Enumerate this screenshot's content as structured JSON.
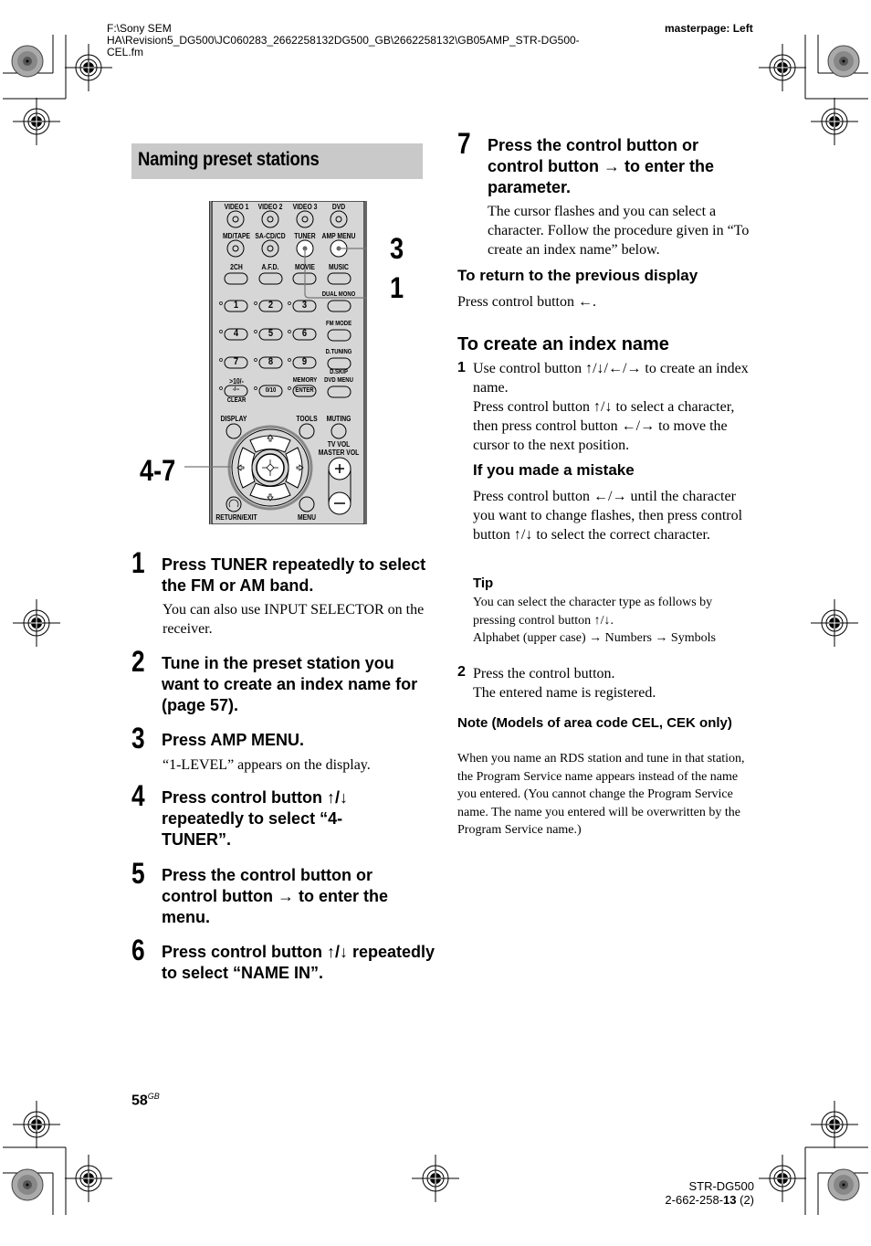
{
  "header": {
    "file_path_lines": [
      "F:\\Sony SEM",
      "HA\\Revision5_DG500\\JC060283_2662258132DG500_GB\\2662258132\\GB05AMP_STR-DG500-",
      "CEL.fm"
    ],
    "masterpage": "masterpage: Left"
  },
  "section": {
    "title": "Naming preset stations"
  },
  "figure": {
    "callouts": {
      "c3": "3",
      "c1": "1",
      "c47": "4-7"
    },
    "remote_buttons": {
      "row1": [
        "VIDEO 1",
        "VIDEO 2",
        "VIDEO 3",
        "DVD"
      ],
      "row2": [
        "MD/TAPE",
        "SA-CD/CD",
        "TUNER",
        "AMP MENU"
      ],
      "row3": [
        "2CH",
        "A.F.D.",
        "MOVIE",
        "MUSIC"
      ],
      "num_row1": [
        "1",
        "2",
        "3"
      ],
      "num_row1_side": "DUAL MONO",
      "num_row2": [
        "4",
        "5",
        "6"
      ],
      "num_row2_side": "FM MODE",
      "num_row3": [
        "7",
        "8",
        "9"
      ],
      "num_row3_side": "D.TUNING",
      "ten_label": ">10/-",
      "ten_key": "-/--",
      "clear": "CLEAR",
      "zero_key": "0/10",
      "memory": "MEMORY",
      "enter": "ENTER",
      "dskip": "D.SKIP",
      "dvd_menu": "DVD MENU",
      "display": "DISPLAY",
      "tools": "TOOLS",
      "muting": "MUTING",
      "tv_vol": "TV VOL",
      "master_vol": "MASTER VOL",
      "return_exit": "RETURN/EXIT",
      "menu": "MENU"
    }
  },
  "steps_left": [
    {
      "num": "1",
      "title": "Press TUNER repeatedly to select the FM or AM band.",
      "body": "You can also use INPUT SELECTOR on the receiver."
    },
    {
      "num": "2",
      "title": "Tune in the preset station you want to create an index name for (page 57).",
      "body": ""
    },
    {
      "num": "3",
      "title": "Press AMP MENU.",
      "body": "“1-LEVEL” appears on the display."
    },
    {
      "num": "4",
      "title": "Press control button ↑/↓ repeatedly to select “4-TUNER”.",
      "body": ""
    },
    {
      "num": "5",
      "title": "Press the control button or control button → to enter the menu.",
      "body": ""
    },
    {
      "num": "6",
      "title": "Press control button ↑/↓ repeatedly to select “NAME IN”.",
      "body": ""
    }
  ],
  "step7": {
    "num": "7",
    "title": "Press the control button or control button → to enter the parameter.",
    "body": "The cursor flashes and you can select a character. Follow the procedure given in “To create an index name” below."
  },
  "return_section": {
    "title": "To return to the previous display",
    "body": "Press control button ←."
  },
  "create_section": {
    "title": "To create an index name",
    "sub1_num": "1",
    "sub1_text": "Use control button ↑/↓/←/→ to create an index name.",
    "sub1_text2": "Press control button ↑/↓ to select a character, then press control button ←/→ to move the cursor to the next position.",
    "mistake_title": "If you made a mistake",
    "mistake_body": "Press control button ←/→ until the character you want to change flashes, then press control button ↑/↓ to select the correct character.",
    "tip_title": "Tip",
    "tip_body": "You can select the character type as follows by pressing control button ↑/↓.",
    "tip_sequence": "Alphabet (upper case) → Numbers → Symbols",
    "sub2_num": "2",
    "sub2_text": "Press the control button.",
    "sub2_text2": "The entered name is registered."
  },
  "note": {
    "title": "Note (Models of area code CEL, CEK only)",
    "body": "When you name an RDS station and tune in that station, the Program Service name appears instead of the name you entered. (You cannot change the Program Service name. The name you entered will be overwritten by the Program Service name.)"
  },
  "footer": {
    "page_number": "58",
    "page_suffix": "GB",
    "model": "STR-DG500",
    "code_prefix": "2-662-258-",
    "code_bold": "13",
    "code_suffix": " (2)"
  }
}
